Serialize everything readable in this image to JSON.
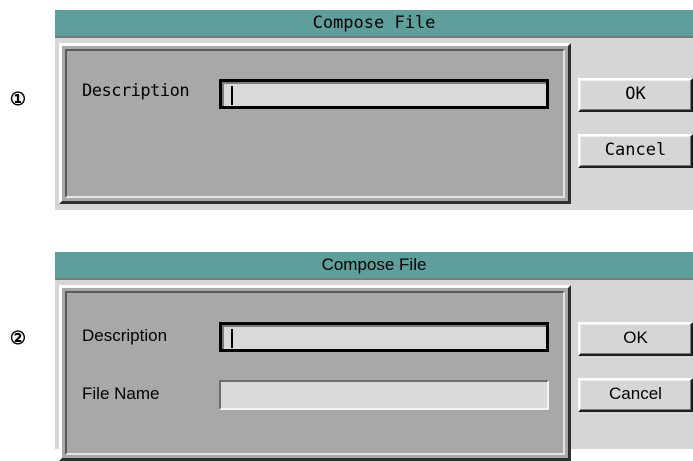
{
  "dialogs": [
    {
      "marker": "①",
      "title": "Compose File",
      "fields": [
        {
          "label": "Description",
          "value": ""
        }
      ],
      "ok_label": "OK",
      "cancel_label": "Cancel"
    },
    {
      "marker": "②",
      "title": "Compose File",
      "fields": [
        {
          "label": "Description",
          "value": ""
        },
        {
          "label": "File Name",
          "value": ""
        }
      ],
      "ok_label": "OK",
      "cancel_label": "Cancel"
    }
  ],
  "colors": {
    "titlebar": "#5e9e9b",
    "dialog_bg": "#d6d6d6",
    "panel_bg": "#a8a8a8",
    "field_bg": "#d9d9d9"
  }
}
